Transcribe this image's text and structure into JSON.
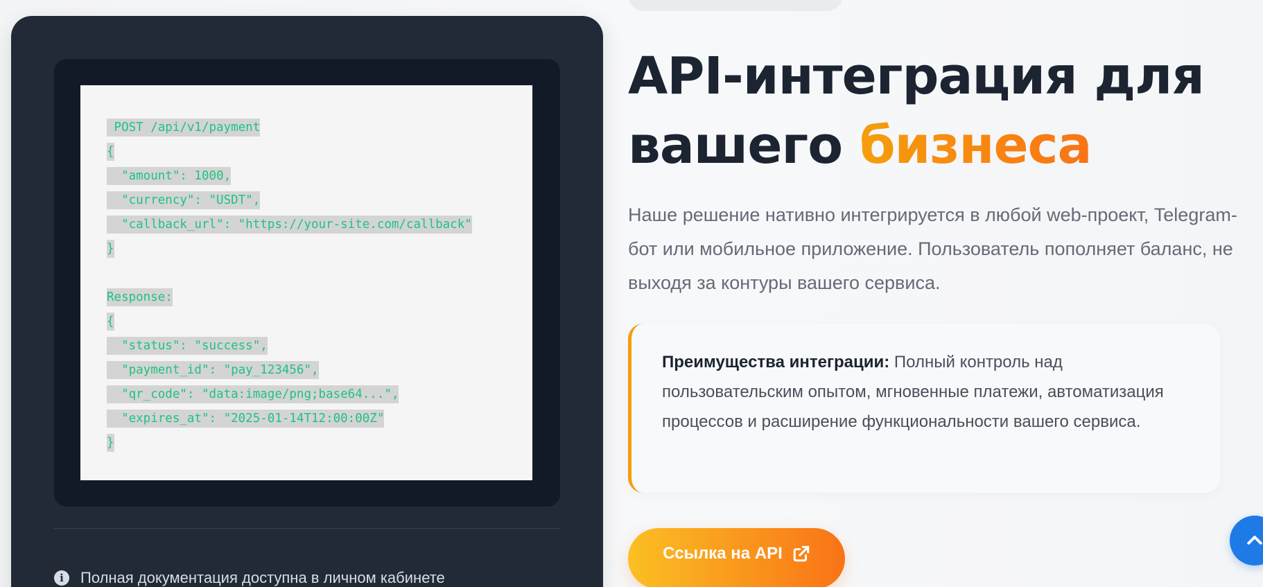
{
  "code_sample": {
    "request_lines": [
      " POST /api/v1/payment",
      "{",
      "  \"amount\": 1000,",
      "  \"currency\": \"USDT\",",
      "  \"callback_url\": \"https://your-site.com/callback\"",
      "}"
    ],
    "response_lines": [
      "Response:",
      "{",
      "  \"status\": \"success\",",
      "  \"payment_id\": \"pay_123456\",",
      "  \"qr_code\": \"data:image/png;base64...\",",
      "  \"expires_at\": \"2025-01-14T12:00:00Z\"",
      "}"
    ]
  },
  "docs_note": {
    "icon": "info-icon",
    "text": "Полная документация доступна в личном кабинете"
  },
  "hero": {
    "title_part1": "API-интеграция для вашего ",
    "title_accent": "бизнеса",
    "description": "Наше решение нативно интегрируется в любой web-проект, Telegram-бот или мобильное приложение. Пользователь пополняет баланс, не выходя за контуры вашего сервиса."
  },
  "benefit": {
    "label": "Преимущества интеграции:",
    "text": " Полный контроль над пользовательским опытом, мгновенные платежи, автоматизация процессов и расширение функциональности вашего сервиса."
  },
  "api_button": {
    "label": "Ссылка на API",
    "icon": "external-link-icon"
  },
  "scroll_top": {
    "icon": "chevron-up-icon"
  },
  "colors": {
    "dark_card": "#222a37",
    "code_text": "#1ec381",
    "accent_start": "#f59e0b",
    "accent_end": "#f97316",
    "scroll_button": "#1e7ae6"
  }
}
